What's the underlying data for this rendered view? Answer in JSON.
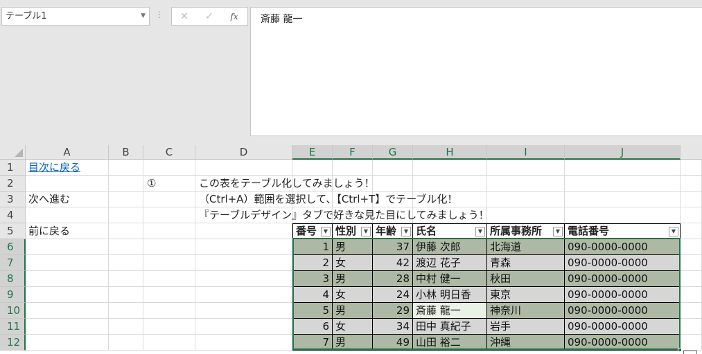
{
  "namebox": {
    "value": "テーブル1"
  },
  "formula_bar": {
    "cancel_icon": "✕",
    "enter_icon": "✓",
    "fx_label": "fx",
    "content": "斎藤 龍一"
  },
  "columns": [
    "A",
    "B",
    "C",
    "D",
    "E",
    "F",
    "G",
    "H",
    "I",
    "J"
  ],
  "rows": [
    "1",
    "2",
    "3",
    "4",
    "5",
    "6",
    "7",
    "8",
    "9",
    "10",
    "11",
    "12"
  ],
  "cells": {
    "a1": "目次に戻る",
    "c2": "①",
    "d2": "この表をテーブル化してみましょう！",
    "a3": "次へ進む",
    "d3": "（Ctrl+A）範囲を選択して、【Ctrl+T】でテーブル化！",
    "a5": "前に戻る",
    "d4": "『テーブルデザイン』タブで好きな見た目にしてみましょう！"
  },
  "table": {
    "headers": [
      "番号",
      "性別",
      "年齢",
      "氏名",
      "所属事務所",
      "電話番号"
    ],
    "rows": [
      [
        "1",
        "男",
        "37",
        "伊藤 次郎",
        "北海道",
        "090-0000-0000"
      ],
      [
        "2",
        "女",
        "42",
        "渡辺 花子",
        "青森",
        "090-0000-0000"
      ],
      [
        "3",
        "男",
        "28",
        "中村 健一",
        "秋田",
        "090-0000-0000"
      ],
      [
        "4",
        "女",
        "24",
        "小林 明日香",
        "東京",
        "090-0000-0000"
      ],
      [
        "5",
        "男",
        "29",
        "斎藤 龍一",
        "神奈川",
        "090-0000-0000"
      ],
      [
        "6",
        "女",
        "34",
        "田中 真紀子",
        "岩手",
        "090-0000-0000"
      ],
      [
        "7",
        "男",
        "49",
        "山田 裕二",
        "沖縄",
        "090-0000-0000"
      ]
    ]
  },
  "colors": {
    "table_odd": "#adb9a5",
    "table_even": "#d6d6d6",
    "selection": "#217346",
    "link": "#0563c1"
  }
}
